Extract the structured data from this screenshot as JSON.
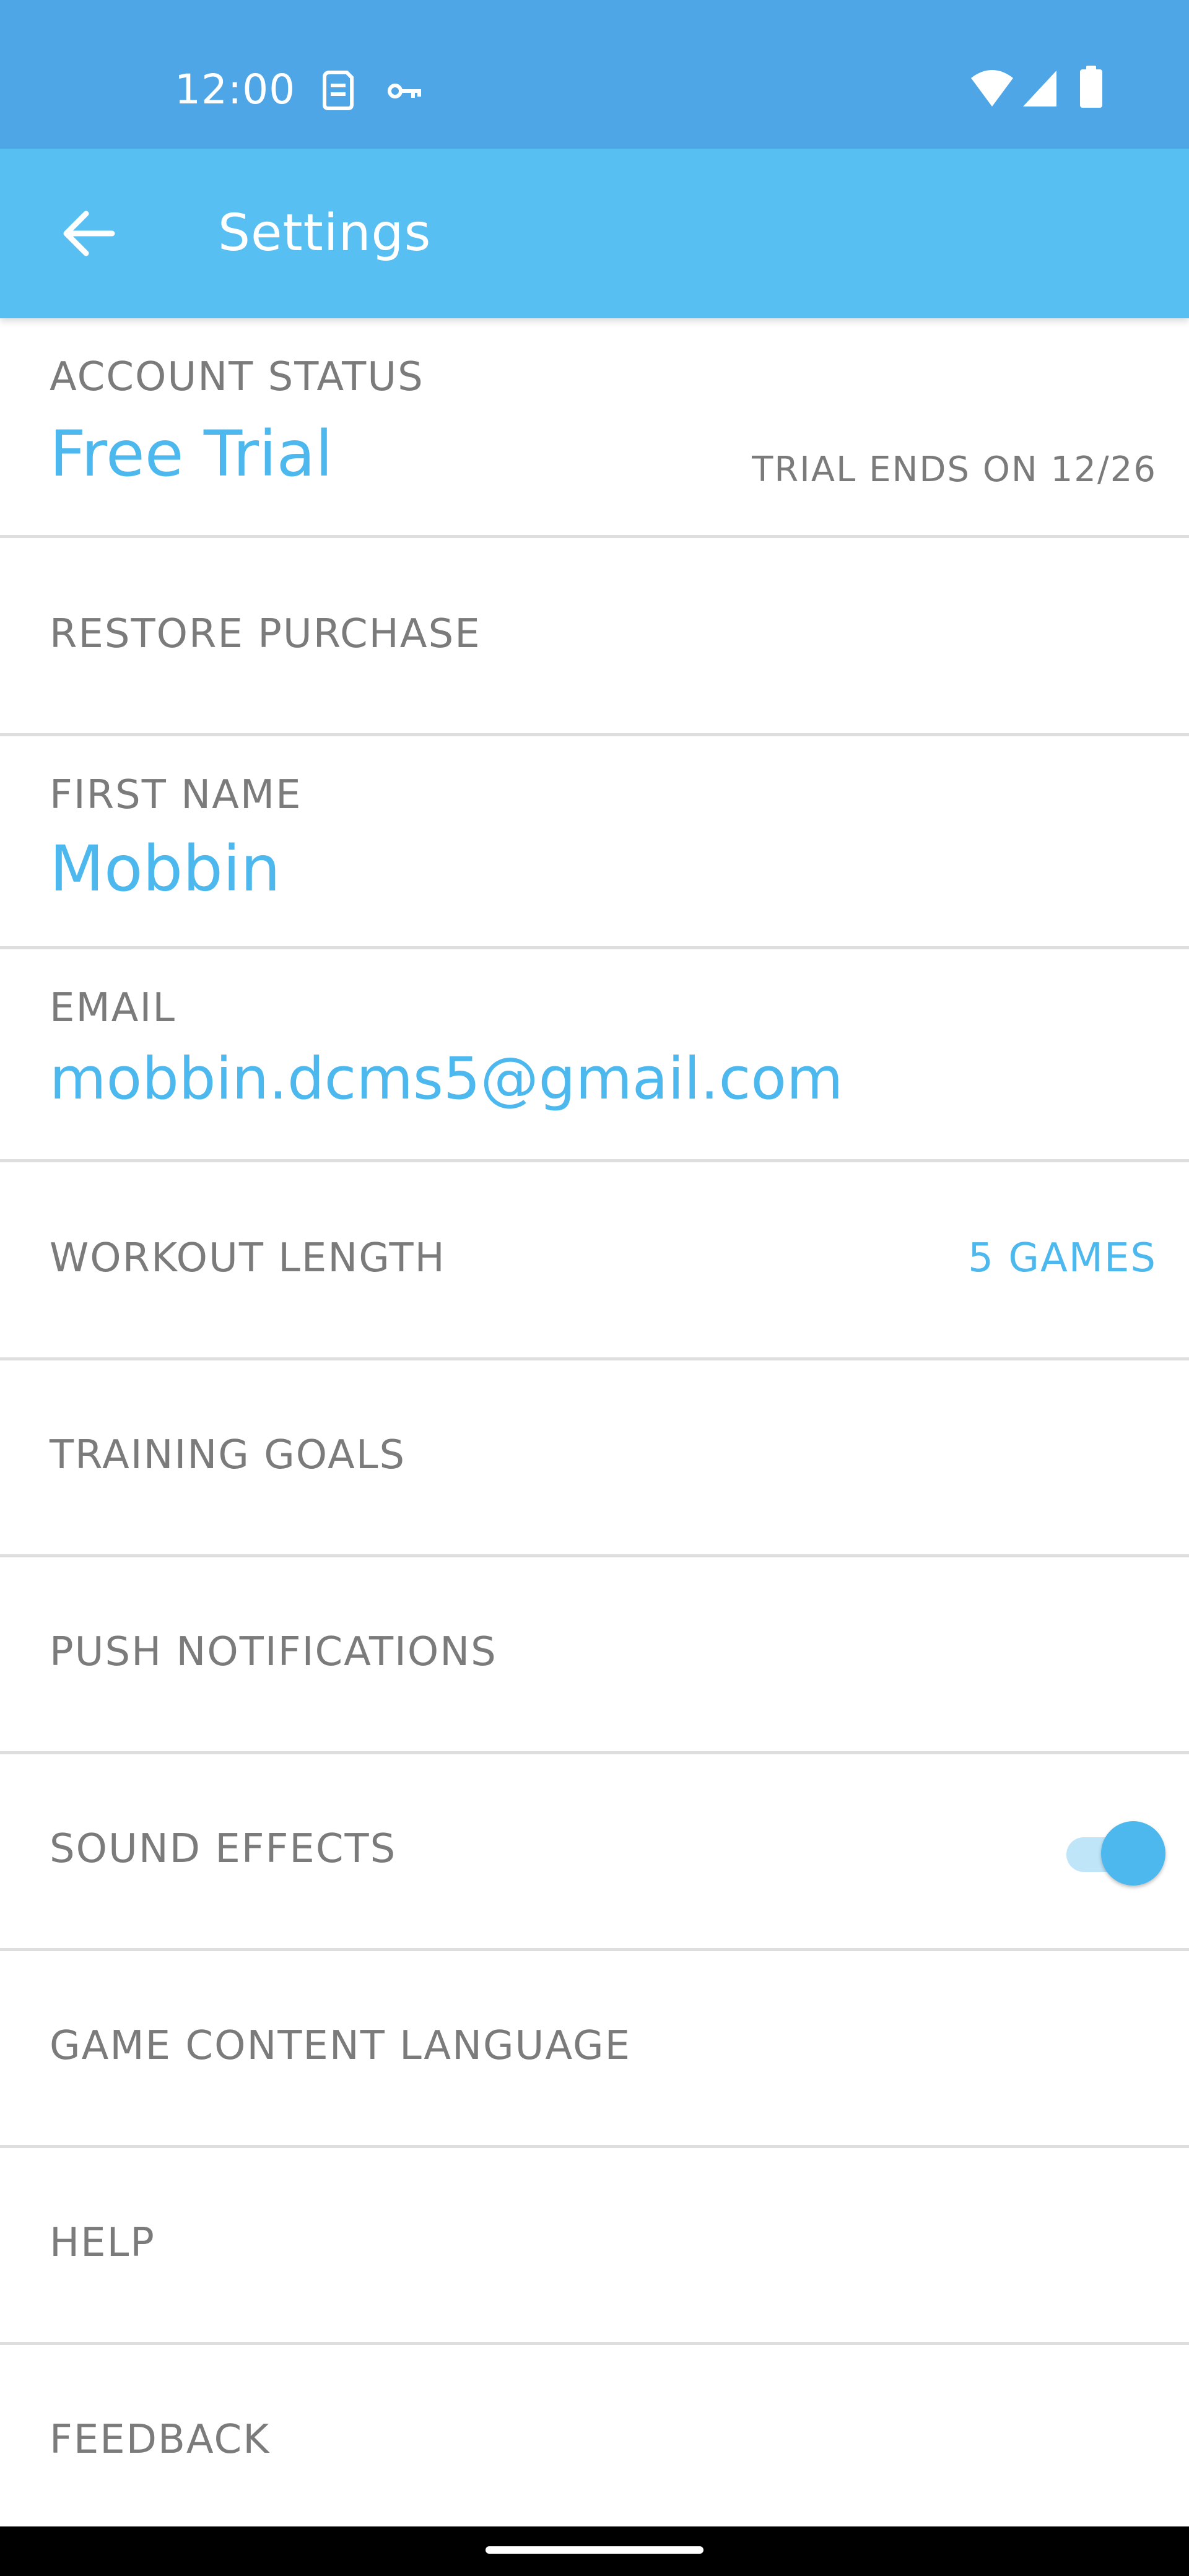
{
  "status_bar": {
    "time": "12:00",
    "icons": [
      "sim-card-icon",
      "vpn-key-icon",
      "wifi-icon",
      "signal-icon",
      "battery-icon"
    ]
  },
  "app_bar": {
    "title": "Settings",
    "back_icon": "arrow-back-icon"
  },
  "colors": {
    "status_bar": "#4ea6e6",
    "app_bar": "#58bff2",
    "accent": "#4cb8ee",
    "label": "#7b7b7b",
    "divider": "#dedede"
  },
  "settings": {
    "account_status": {
      "label": "ACCOUNT STATUS",
      "value": "Free Trial",
      "trial_note": "TRIAL ENDS ON 12/26"
    },
    "restore_purchase": {
      "label": "RESTORE PURCHASE"
    },
    "first_name": {
      "label": "FIRST NAME",
      "value": "Mobbin"
    },
    "email": {
      "label": "EMAIL",
      "value": "mobbin.dcms5@gmail.com"
    },
    "workout_length": {
      "label": "WORKOUT LENGTH",
      "value": "5 GAMES"
    },
    "training_goals": {
      "label": "TRAINING GOALS"
    },
    "push_notifications": {
      "label": "PUSH NOTIFICATIONS"
    },
    "sound_effects": {
      "label": "SOUND EFFECTS",
      "enabled": true
    },
    "game_content_language": {
      "label": "GAME CONTENT LANGUAGE"
    },
    "help": {
      "label": "HELP"
    },
    "feedback": {
      "label": "FEEDBACK"
    }
  }
}
